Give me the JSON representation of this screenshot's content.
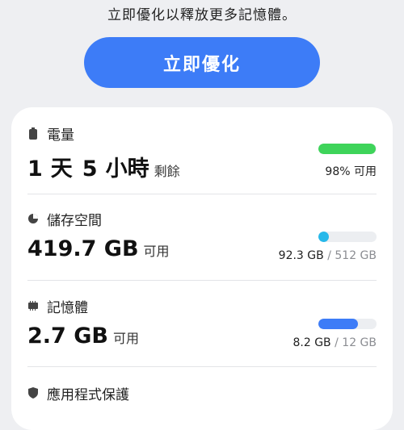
{
  "hint": "立即優化以釋放更多記憶體。",
  "optimize_button": "立即優化",
  "battery": {
    "title": "電量",
    "value_parts": [
      "1",
      "天",
      "5",
      "小時"
    ],
    "suffix": "剩餘",
    "status": "98% 可用",
    "level": 0.98,
    "color": "#3ed45a"
  },
  "storage": {
    "title": "儲存空間",
    "value": "419.7 GB",
    "suffix": "可用",
    "used": "92.3 GB",
    "separator": " / ",
    "total": "512 GB",
    "level": 0.18,
    "color": "#26b8ea"
  },
  "memory": {
    "title": "記憶體",
    "value": "2.7 GB",
    "suffix": "可用",
    "used": "8.2 GB",
    "separator": " / ",
    "total": "12 GB",
    "level": 0.68,
    "color": "#3d7cf7"
  },
  "app_protection": {
    "title": "應用程式保護"
  },
  "colors": {
    "accent": "#3d7cf7",
    "background": "#eeeff2",
    "muted": "#8b8d92"
  }
}
